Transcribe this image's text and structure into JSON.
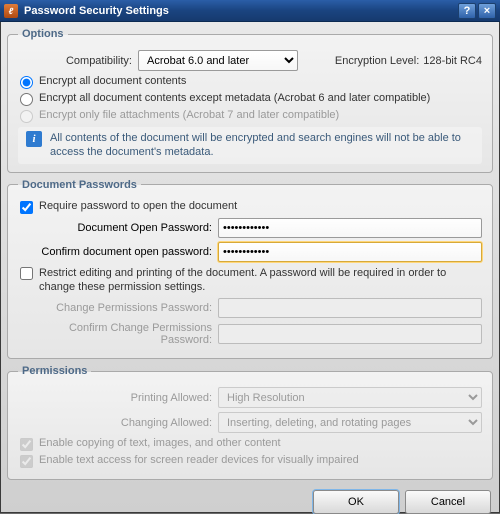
{
  "title": "Password Security Settings",
  "help_symbol": "?",
  "close_symbol": "×",
  "app_icon_glyph": "ℓ",
  "options": {
    "legend": "Options",
    "compatibility_label": "Compatibility:",
    "compatibility_value": "Acrobat 6.0 and later",
    "encryption_label": "Encryption Level:",
    "encryption_value": "128-bit RC4",
    "radio_all": "Encrypt all document contents",
    "radio_except_meta": "Encrypt all document contents except metadata (Acrobat 6 and later compatible)",
    "radio_attachments": "Encrypt only file attachments (Acrobat 7 and later compatible)",
    "info_glyph": "i",
    "info_text": "All contents of the document will be encrypted and search engines will not be able to access the document's metadata."
  },
  "passwords": {
    "legend": "Document Passwords",
    "require_open": "Require password to open the document",
    "open_label": "Document Open Password:",
    "open_value": "••••••••••••",
    "confirm_label": "Confirm document open password:",
    "confirm_value": "••••••••••••",
    "restrict_label": "Restrict editing and printing of the document. A password will be required in order to change these permission settings.",
    "change_perm_label": "Change Permissions Password:",
    "confirm_change_perm_label": "Confirm Change Permissions Password:"
  },
  "permissions": {
    "legend": "Permissions",
    "printing_label": "Printing Allowed:",
    "printing_value": "High Resolution",
    "changing_label": "Changing Allowed:",
    "changing_value": "Inserting, deleting, and rotating pages",
    "enable_copy": "Enable copying of text, images, and other content",
    "enable_screenreader": "Enable text access for screen reader devices for visually impaired"
  },
  "buttons": {
    "ok": "OK",
    "cancel": "Cancel"
  }
}
